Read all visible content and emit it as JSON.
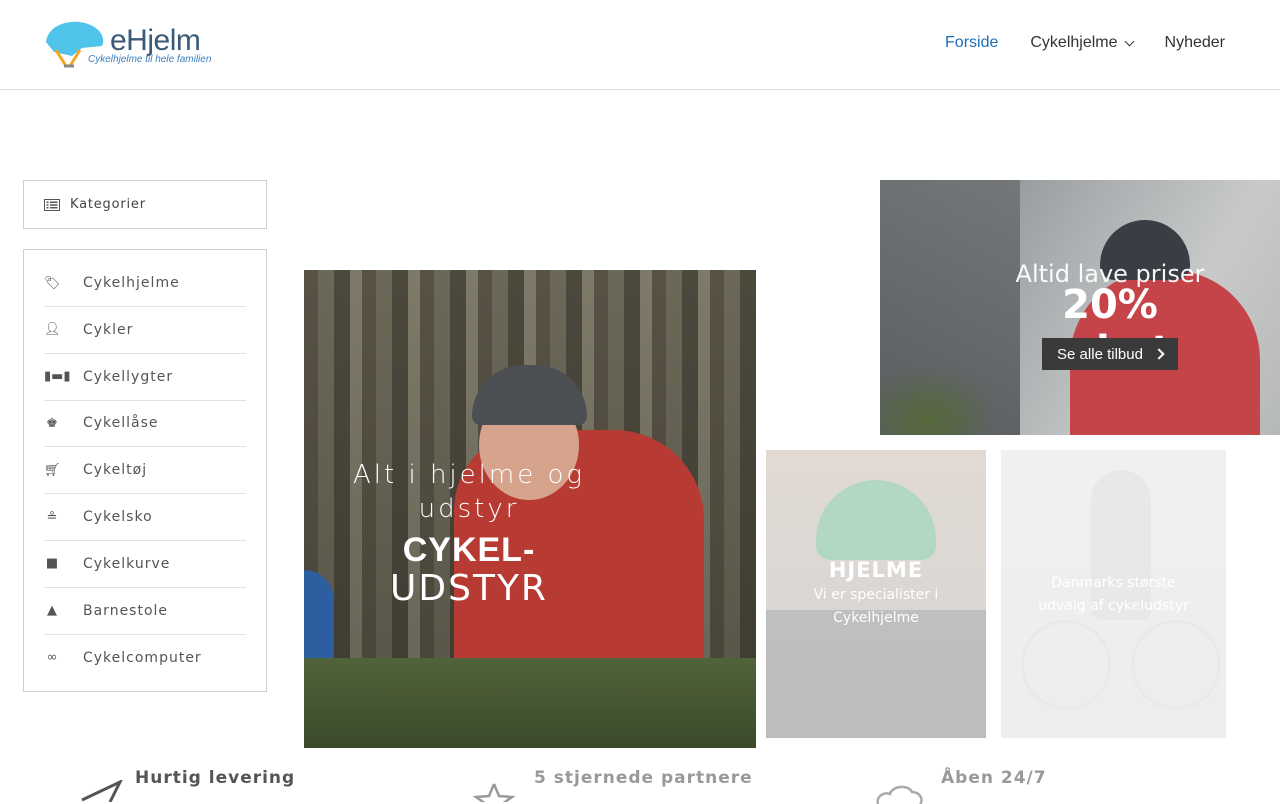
{
  "header": {
    "logo_text": "eHjelm",
    "logo_tagline": "Cykelhjelme til hele familien",
    "nav": [
      {
        "label": "Forside",
        "active": true
      },
      {
        "label": "Cykelhjelme",
        "has_dropdown": true
      },
      {
        "label": "Nyheder"
      }
    ]
  },
  "sidebar": {
    "title": "Kategorier",
    "items": [
      {
        "label": "Cykelhjelme",
        "icon": "tag-icon"
      },
      {
        "label": "Cykler",
        "icon": "user-cog-icon"
      },
      {
        "label": "Cykellygter",
        "icon": "dumbbell-icon"
      },
      {
        "label": "Cykellåse",
        "icon": "chess-king-icon"
      },
      {
        "label": "Cykeltøj",
        "icon": "cart-icon"
      },
      {
        "label": "Cykelsko",
        "icon": "shoe-icon"
      },
      {
        "label": "Cykelkurve",
        "icon": "bag-icon"
      },
      {
        "label": "Barnestole",
        "icon": "triangle-icon"
      },
      {
        "label": "Cykelcomputer",
        "icon": "bicycle-icon"
      }
    ]
  },
  "hero": {
    "line1": "Alt i hjelme og udstyr",
    "line2": "CYKEL-",
    "line3": "UDSTYR"
  },
  "promo": {
    "line1": "Altid lave priser",
    "line2": "20% rabat",
    "button": "Se alle tilbud"
  },
  "tile_helmets": {
    "title": "HJELME",
    "subtitle": "Vi er specialister i Cykelhjelme"
  },
  "tile_gear": {
    "subtitle": "Danmarks største udvalg af cykeludstyr"
  },
  "features": [
    {
      "label": "Hurtig levering",
      "icon": "paper-plane-icon"
    },
    {
      "label": "5 stjernede partnere",
      "icon": "star-icon"
    },
    {
      "label": "Åben 24/7",
      "icon": "cloud-icon"
    }
  ],
  "colors": {
    "nav_active": "#1e6db7",
    "logo_blue": "#3a5a78"
  }
}
